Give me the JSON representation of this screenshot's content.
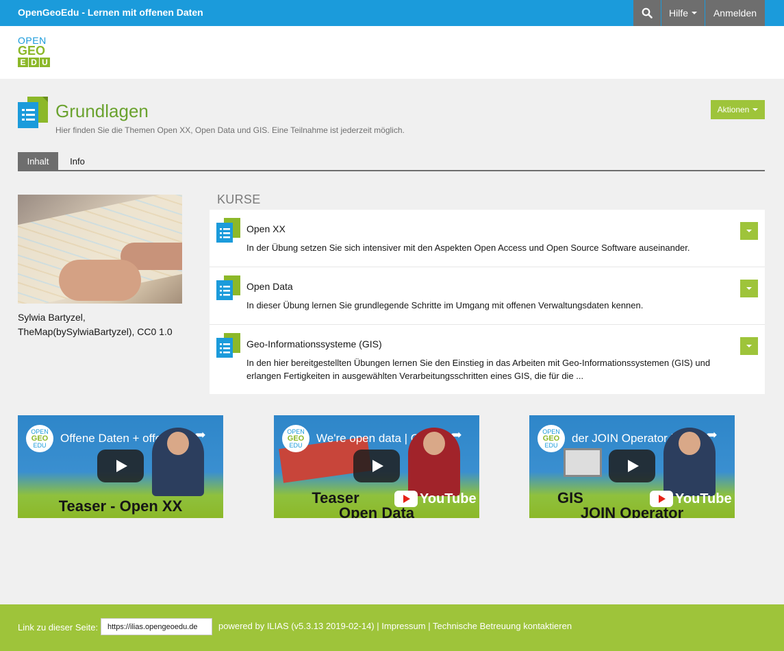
{
  "topbar": {
    "brand": "OpenGeoEdu - Lernen mit offenen Daten",
    "help_label": "Hilfe",
    "login_label": "Anmelden"
  },
  "logo": {
    "line1": "OPEN",
    "line2": "GEO",
    "line3": [
      "E",
      "D",
      "U"
    ]
  },
  "header": {
    "title": "Grundlagen",
    "description": "Hier finden Sie die Themen Open XX, Open Data und GIS. Eine Teilnahme ist jederzeit möglich.",
    "actions_label": "Aktionen"
  },
  "tabs": [
    {
      "label": "Inhalt",
      "active": true
    },
    {
      "label": "Info",
      "active": false
    }
  ],
  "image_caption": {
    "line1": "Sylwia Bartyzel,",
    "line2": "TheMap(bySylwiaBartyzel), CC0 1.0"
  },
  "kurse": {
    "heading": "KURSE",
    "items": [
      {
        "title": "Open XX",
        "description": "In der Übung setzen Sie sich intensiver mit den Aspekten Open Access und Open Source Software auseinander."
      },
      {
        "title": "Open Data",
        "description": "In dieser Übung lernen Sie grundlegende Schritte im Umgang mit offenen Verwaltungsdaten kennen."
      },
      {
        "title": "Geo-Informationssysteme (GIS)",
        "description": "In den hier bereitgestellten Übungen lernen Sie den Einstieg in das Arbeiten mit Geo-Informationssystemen (GIS) und erlangen Fertigkeiten in ausgewählten Verarbeitungsschritten eines GIS, die für die ..."
      }
    ]
  },
  "videos": [
    {
      "title": "Offene Daten + offene...",
      "caption": "Teaser - Open XX",
      "caption2": ""
    },
    {
      "title": "We're open data | Ope...",
      "caption": "Teaser",
      "caption2": "Open Data",
      "youtube": "YouTube"
    },
    {
      "title": "der JOIN Operator | O...",
      "caption": "GIS",
      "caption2": "JOIN Operator",
      "youtube": "YouTube"
    }
  ],
  "footer": {
    "link_label": "Link zu dieser Seite:",
    "link_value": "https://ilias.opengeoedu.de",
    "powered": "powered by ILIAS (v5.3.13 2019-02-14)",
    "impressum": "Impressum",
    "support": "Technische Betreuung kontaktieren",
    "separator": "|"
  },
  "colors": {
    "topbar": "#1b9bdb",
    "accent_green": "#9ec43a",
    "title_green": "#6aa22e",
    "dark_gray": "#6e6e6e"
  }
}
